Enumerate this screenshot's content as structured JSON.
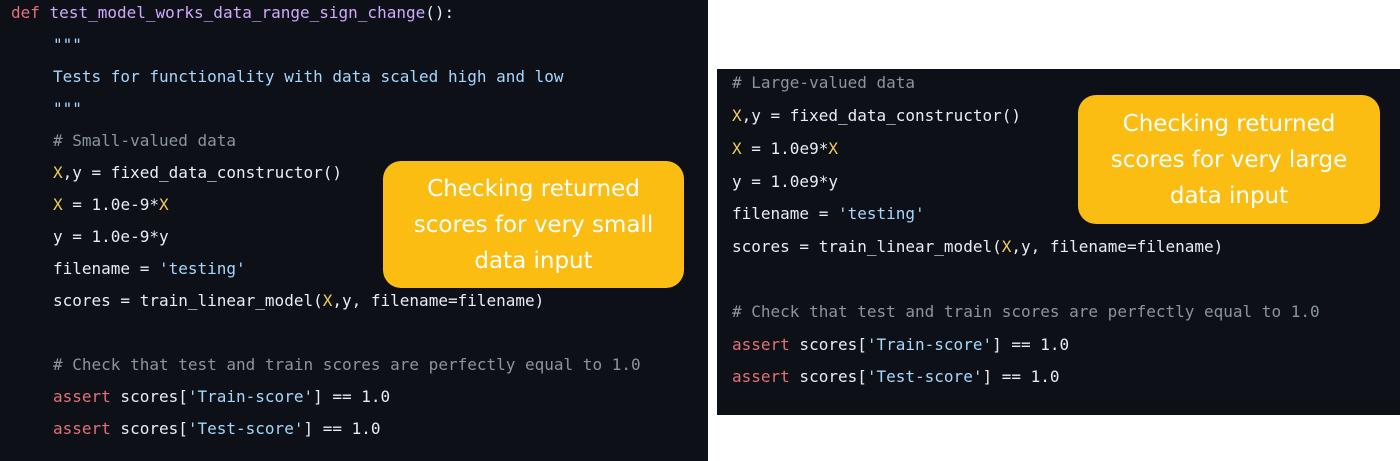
{
  "left": {
    "l1": {
      "kw": "def",
      "fn": "test_model_works_data_range_sign_change",
      "rest": "():"
    },
    "l2": "\"\"\"",
    "l3": "Tests for functionality with data scaled high and low",
    "l4": "\"\"\"",
    "l5": "# Small-valued data",
    "l6": {
      "v1": "X",
      "a": ",y = fixed_data_constructor()"
    },
    "l7": {
      "v1": "X",
      "a": " = 1.0e-9*",
      "v2": "X"
    },
    "l8": "y = 1.0e-9*y",
    "l9": {
      "a": "filename = ",
      "s": "'testing'"
    },
    "l10": {
      "a": "scores = train_linear_model(",
      "v1": "X",
      "b": ",y, filename=filename)"
    },
    "l11": "# Check that test and train scores are perfectly equal to 1.0",
    "l12": {
      "k": "assert",
      "a": " scores[",
      "s": "'Train-score'",
      "b": "] == 1.0"
    },
    "l13": {
      "k": "assert",
      "a": " scores[",
      "s": "'Test-score'",
      "b": "] == 1.0"
    },
    "callout": "Checking returned scores for very small data input"
  },
  "right": {
    "l1": "# Large-valued data",
    "l2": {
      "v1": "X",
      "a": ",y = fixed_data_constructor()"
    },
    "l3": {
      "v1": "X",
      "a": " = 1.0e9*",
      "v2": "X"
    },
    "l4": "y = 1.0e9*y",
    "l5": {
      "a": "filename = ",
      "s": "'testing'"
    },
    "l6": {
      "a": "scores = train_linear_model(",
      "v1": "X",
      "b": ",y, filename=filename)"
    },
    "l7": "# Check that test and train scores are perfectly equal to 1.0",
    "l8": {
      "k": "assert",
      "a": " scores[",
      "s": "'Train-score'",
      "b": "] == 1.0"
    },
    "l9": {
      "k": "assert",
      "a": " scores[",
      "s": "'Test-score'",
      "b": "] == 1.0"
    },
    "callout": "Checking returned scores for very large data input"
  },
  "colors": {
    "background": "#0d1117",
    "keyword": "#e36f7a",
    "function": "#d2a8ff",
    "comment": "#8b949e",
    "string": "#a5d6ff",
    "variable": "#f2cc60",
    "callout": "#fcbd13"
  }
}
